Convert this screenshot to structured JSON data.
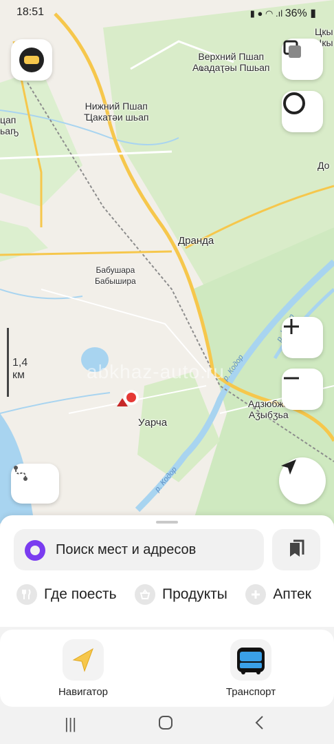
{
  "status": {
    "time": "18:51",
    "battery": "36%"
  },
  "map": {
    "places": {
      "verkhniy_pshap": "Верхний Пшап",
      "verkhniy_pshap_local": "Аҩадаҭәы Пшьап",
      "nizhniy_pshap": "Нижний Пшап",
      "nizhniy_pshap_local": "Ҵакатәи шьап",
      "dranda": "Дранда",
      "babushara": "Бабушара",
      "babushara_local": "Бабышира",
      "uarcha": "Уарча",
      "adzyubzha": "Адзюбжа",
      "adzyubzha_local": "Аӡыбӡьа",
      "edge_left_1": "цап",
      "edge_left_2": "ьаҧ",
      "edge_right_top": "Цкы",
      "edge_right_top2": "Цкы",
      "edge_right_do": "До"
    },
    "rivers": {
      "kodor": "р. Кодор"
    },
    "scale_label": "1,4 км",
    "watermark": "abkhaz-auto.ru"
  },
  "search": {
    "placeholder": "Поиск мест и адресов"
  },
  "categories": [
    {
      "label": "Где поесть",
      "icon": "fork-knife-icon"
    },
    {
      "label": "Продукты",
      "icon": "basket-icon"
    },
    {
      "label": "Аптек",
      "icon": "plus-icon"
    }
  ],
  "apps": [
    {
      "label": "Навигатор",
      "icon": "navigator-arrow-icon"
    },
    {
      "label": "Транспорт",
      "icon": "bus-icon"
    }
  ],
  "colors": {
    "accent": "#7a3cf0",
    "road": "#f6c74c",
    "water": "#a8d4f0",
    "forest": "#cfe9c0",
    "marker": "#e53935"
  }
}
